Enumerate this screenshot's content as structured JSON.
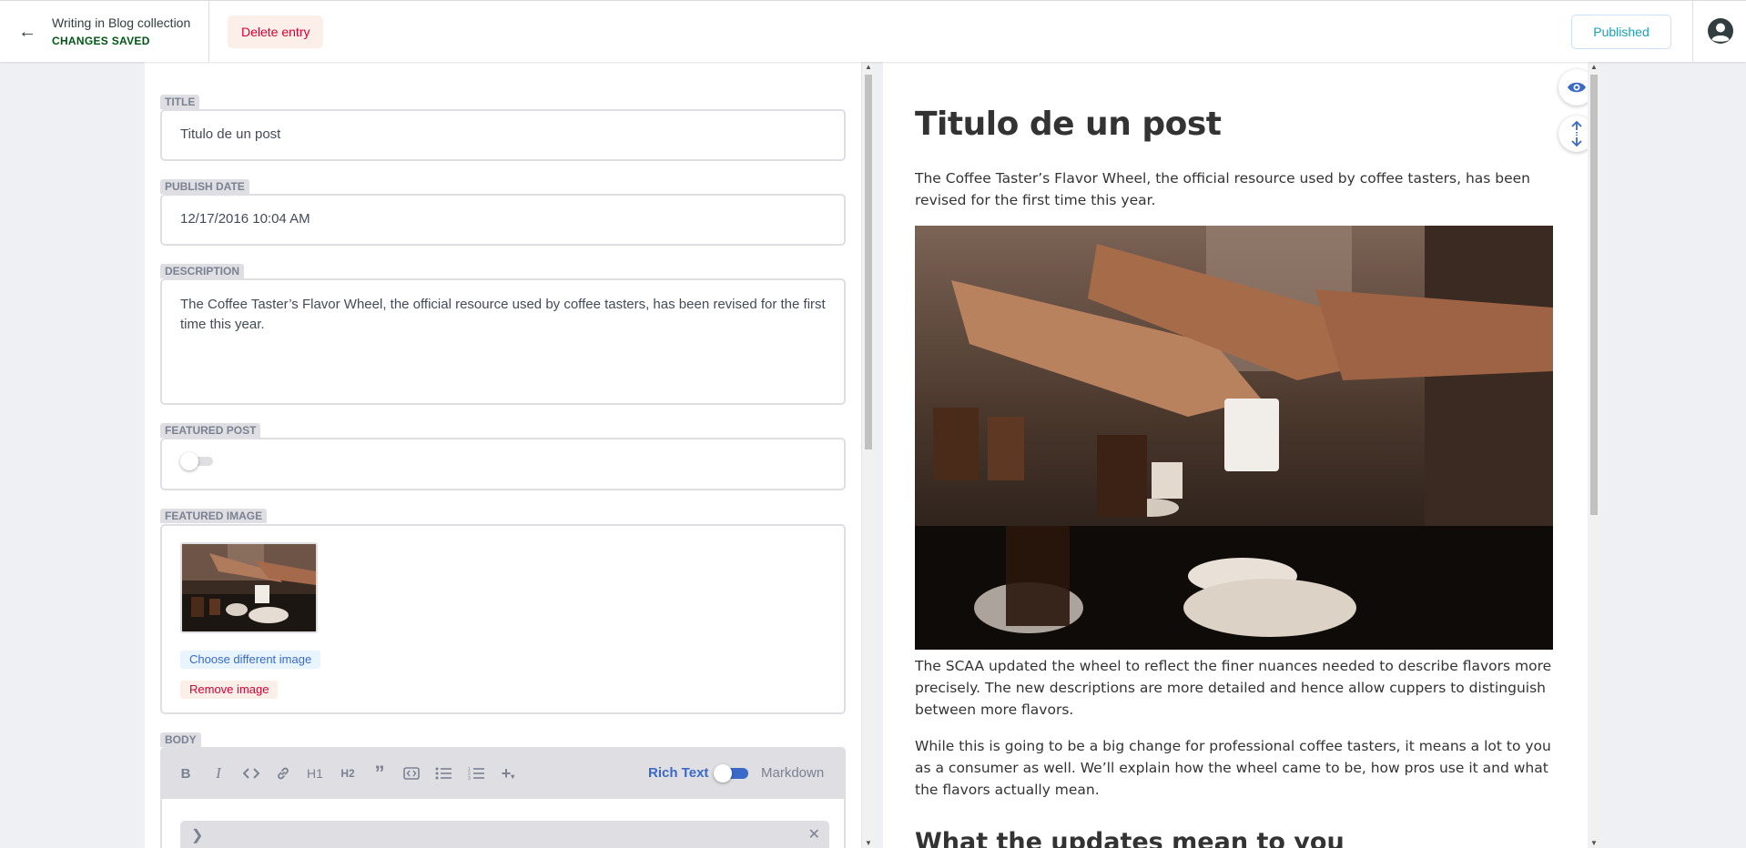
{
  "topbar": {
    "entry_title": "Writing in Blog collection",
    "entry_status": "CHANGES SAVED",
    "delete_label": "Delete entry",
    "publish_label": "Published"
  },
  "fields": {
    "title": {
      "label": "Title",
      "value": "Titulo de un post"
    },
    "publish_date": {
      "label": "Publish Date",
      "value": "12/17/2016 10:04 AM"
    },
    "description": {
      "label": "Description",
      "value": "The Coffee Taster’s Flavor Wheel, the official resource used by coffee tasters, has been revised for the first time this year."
    },
    "featured_post": {
      "label": "Featured Post",
      "checked": false
    },
    "featured_image": {
      "label": "Featured Image",
      "choose_label": "Choose different image",
      "remove_label": "Remove image"
    },
    "body": {
      "label": "Body"
    }
  },
  "toolbar": {
    "buttons": [
      "bold-icon",
      "italic-icon",
      "code-icon",
      "link-icon",
      "heading1-icon",
      "heading2-icon",
      "quote-icon",
      "code-block-icon",
      "bulleted-list-icon",
      "numbered-list-icon",
      "add-component-icon"
    ],
    "h1": "H1",
    "h2": "H2",
    "rich_text_label": "Rich Text",
    "markdown_label": "Markdown",
    "rich_text_enabled": true
  },
  "preview": {
    "title": "Titulo de un post",
    "intro": "The Coffee Taster’s Flavor Wheel, the official resource used by coffee tasters, has been revised for the first time this year.",
    "para1": "The SCAA updated the wheel to reflect the finer nuances needed to describe flavors more precisely. The new descriptions are more detailed and hence allow cuppers to distinguish between more flavors.",
    "para2": "While this is going to be a big change for professional coffee tasters, it means a lot to you as a consumer as well. We’ll explain how the wheel came to be, how pros use it and what the flavors actually mean.",
    "heading2": "What the updates mean to you"
  },
  "colors": {
    "accent": "#3a69c7",
    "saved_green": "#005614",
    "delete_red": "#d60032",
    "published_teal": "#17a2b8"
  }
}
